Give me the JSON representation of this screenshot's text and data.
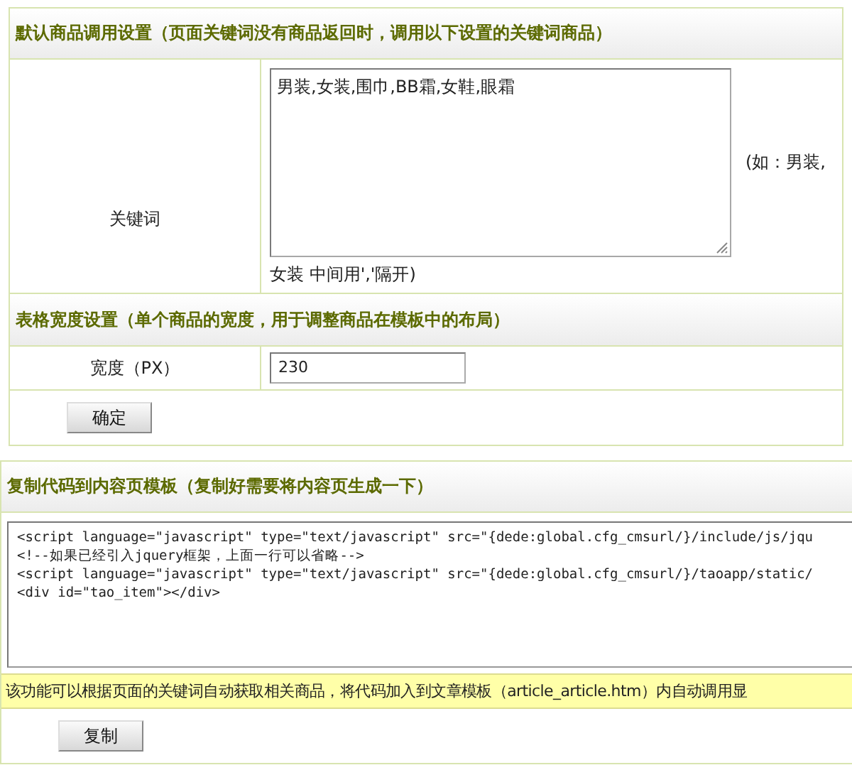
{
  "settings_panel": {
    "title": "默认商品调用设置（页面关键词没有商品返回时，调用以下设置的关键词商品）",
    "keyword_row": {
      "label": "关键词",
      "value": "男装,女装,围巾,BB霜,女鞋,眼霜",
      "hint_right": "(如：男装,",
      "hint_below": "女装 中间用','隔开)"
    },
    "width_section_title": "表格宽度设置（单个商品的宽度，用于调整商品在模板中的布局）",
    "width_row": {
      "label": "宽度（PX）",
      "value": "230"
    },
    "confirm_button": "确定"
  },
  "code_panel": {
    "title": "复制代码到内容页模板（复制好需要将内容页生成一下）",
    "code_lines": [
      "<script language=\"javascript\" type=\"text/javascript\" src=\"{dede:global.cfg_cmsurl/}/include/js/jqu",
      "<!--如果已经引入jquery框架，上面一行可以省略-->",
      "<script language=\"javascript\" type=\"text/javascript\" src=\"{dede:global.cfg_cmsurl/}/taoapp/static/",
      "<div id=\"tao_item\"></div>"
    ],
    "note": "该功能可以根据页面的关键词自动获取相关商品，将代码加入到文章模板（article_article.htm）内自动调用显",
    "copy_button": "复制"
  }
}
